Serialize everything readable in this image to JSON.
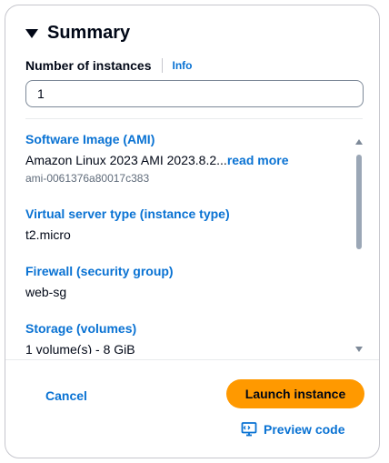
{
  "summary": {
    "title": "Summary",
    "number_of_instances_label": "Number of instances",
    "info_label": "Info",
    "instances_value": "1"
  },
  "details": {
    "ami": {
      "title": "Software Image (AMI)",
      "value": "Amazon Linux 2023 AMI 2023.8.2...",
      "read_more": "read more",
      "id": "ami-0061376a80017c383"
    },
    "instance_type": {
      "title": "Virtual server type (instance type)",
      "value": "t2.micro"
    },
    "firewall": {
      "title": "Firewall (security group)",
      "value": "web-sg"
    },
    "storage": {
      "title": "Storage (volumes)",
      "value": "1 volume(s) - 8 GiB"
    }
  },
  "footer": {
    "cancel_label": "Cancel",
    "launch_label": "Launch instance",
    "preview_label": "Preview code"
  },
  "colors": {
    "link": "#0972d3",
    "primary_button": "#ff9900",
    "text": "#000716"
  }
}
